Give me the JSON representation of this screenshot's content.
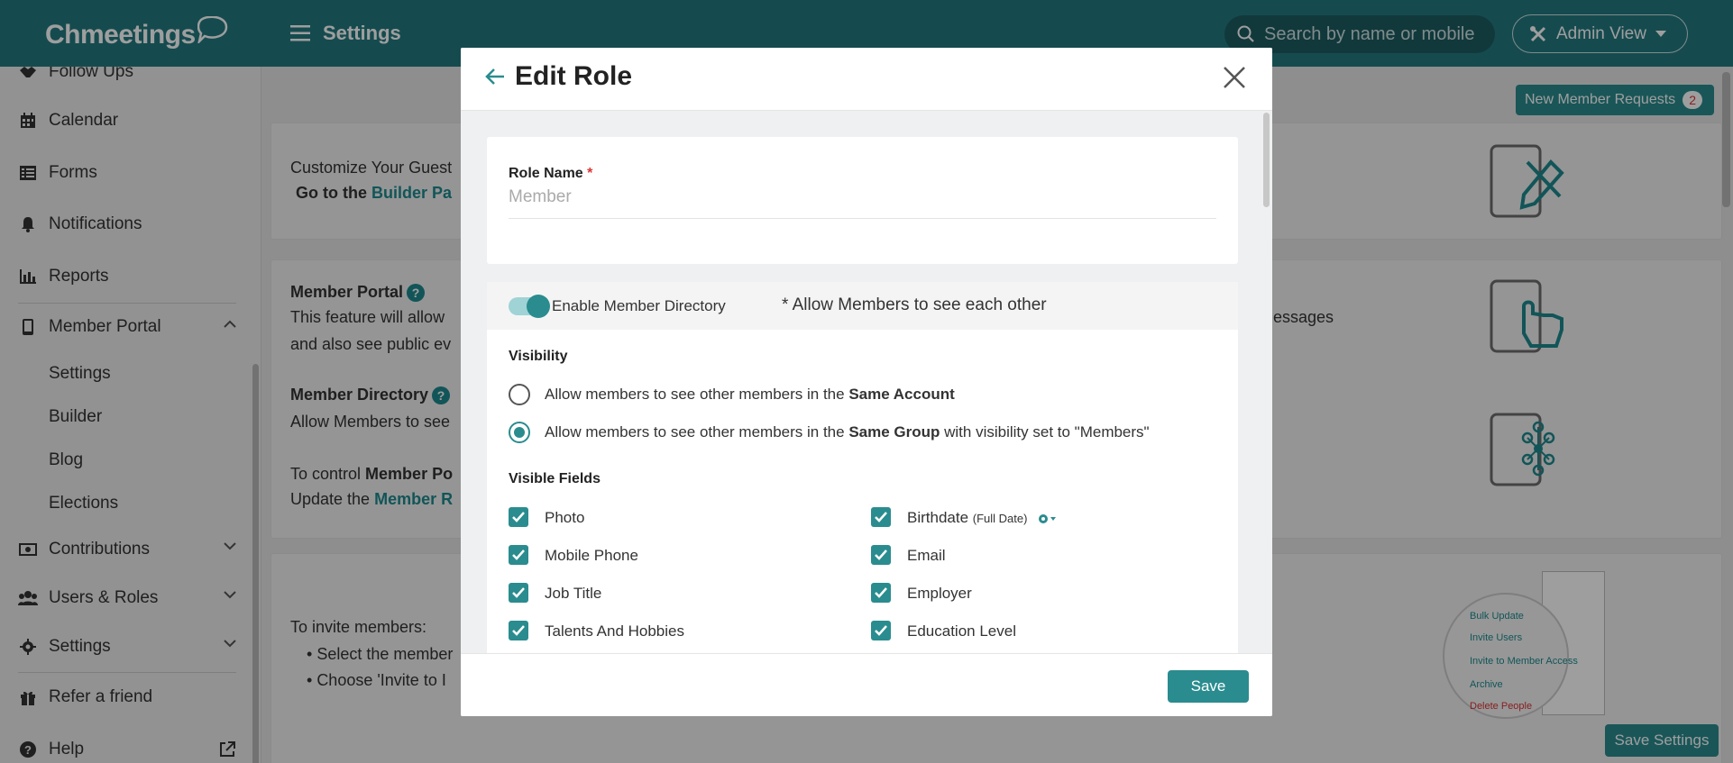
{
  "app": {
    "logo": "Chmeetings",
    "page_title": "Settings",
    "search_placeholder": "Search by name or mobile",
    "admin_view_label": "Admin View",
    "new_member_requests_label": "New Member Requests",
    "new_member_requests_count": "2",
    "save_settings_label": "Save Settings"
  },
  "sidebar": {
    "items": [
      {
        "label": "Follow Ups",
        "icon": "handshake-icon"
      },
      {
        "label": "Calendar",
        "icon": "calendar-icon"
      },
      {
        "label": "Forms",
        "icon": "list-icon"
      },
      {
        "label": "Notifications",
        "icon": "bell-icon"
      },
      {
        "label": "Reports",
        "icon": "bar-chart-icon"
      },
      {
        "label": "Member Portal",
        "icon": "mobile-icon"
      },
      {
        "label": "Contributions",
        "icon": "money-icon"
      },
      {
        "label": "Users & Roles",
        "icon": "users-icon"
      },
      {
        "label": "Settings",
        "icon": "gear-icon"
      },
      {
        "label": "Refer a friend",
        "icon": "gift-icon"
      },
      {
        "label": "Help",
        "icon": "question-icon"
      }
    ],
    "member_portal_sub": [
      "Settings",
      "Builder",
      "Blog",
      "Elections"
    ]
  },
  "background": {
    "customize_line1": "Customize Your Guest",
    "customize_line2_prefix": "Go to the ",
    "customize_line2_link": "Builder Pa",
    "member_portal_title": "Member Portal",
    "member_portal_desc1": "This feature will allow",
    "member_portal_desc1_tail": "essages",
    "member_portal_desc2": "and also see public ev",
    "member_directory_title": "Member Directory",
    "member_directory_desc": "Allow Members to see",
    "control_prefix": "To control ",
    "control_bold": "Member Po",
    "update_prefix": "Update the ",
    "update_link": "Member R",
    "invite_title": "To invite members:",
    "invite_step1": "Select the member",
    "invite_step2": "Choose 'Invite to I",
    "menu_preview": [
      "Bulk Update",
      "Invite Users",
      "Invite to Member Access",
      "Archive",
      "Delete People"
    ]
  },
  "modal": {
    "title": "Edit Role",
    "role_name_label": "Role Name",
    "role_name_required": "*",
    "role_name_placeholder": "Member",
    "enable_directory_label": "Enable Member Directory",
    "enable_directory_on": true,
    "directory_note": "* Allow Members to see each other",
    "visibility_title": "Visibility",
    "visibility_options": [
      {
        "prefix": "Allow members to see other members in the ",
        "bold": "Same Account",
        "suffix": "",
        "selected": false
      },
      {
        "prefix": "Allow members to see other members in the ",
        "bold": "Same Group",
        "suffix": " with visibility set to \"Members\"",
        "selected": true
      }
    ],
    "visible_fields_title": "Visible Fields",
    "fields_left": [
      {
        "label": "Photo",
        "checked": true
      },
      {
        "label": "Mobile Phone",
        "checked": true
      },
      {
        "label": "Job Title",
        "checked": true
      },
      {
        "label": "Talents And Hobbies",
        "checked": true
      }
    ],
    "fields_right": [
      {
        "label": "Birthdate",
        "note": "(Full Date)",
        "checked": true
      },
      {
        "label": "Email",
        "checked": true
      },
      {
        "label": "Employer",
        "checked": true
      },
      {
        "label": "Education Level",
        "checked": true
      }
    ],
    "save_label": "Save"
  },
  "colors": {
    "topbar": "#237a80",
    "accent": "#2a8c8f",
    "required": "#dd3333"
  }
}
